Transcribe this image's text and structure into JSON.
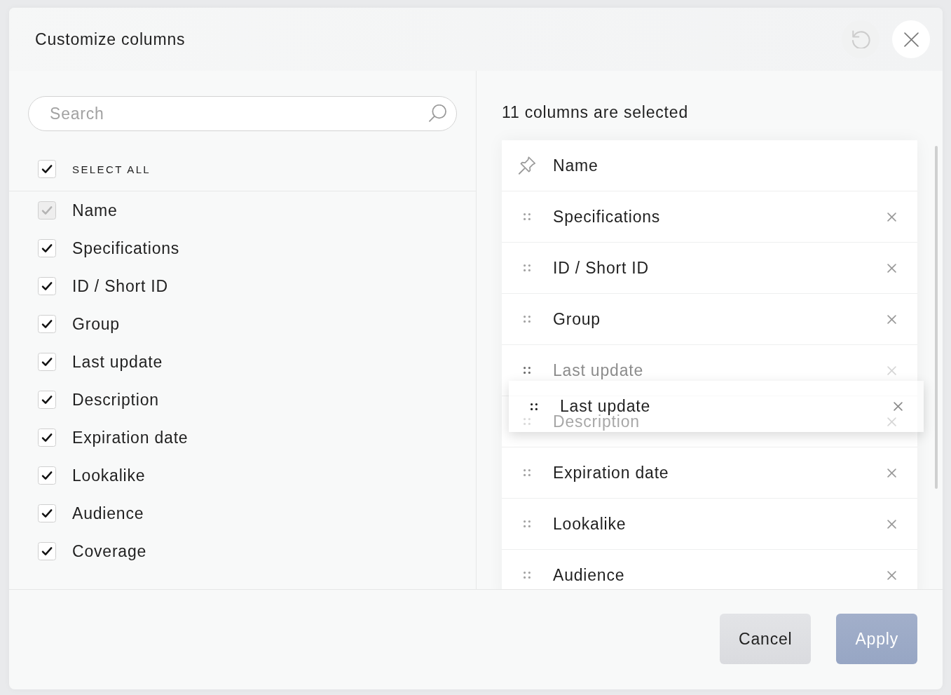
{
  "dialog": {
    "title": "Customize columns",
    "header_actions": [
      {
        "kind": "reset",
        "disabled": true
      },
      {
        "kind": "close",
        "disabled": false
      }
    ]
  },
  "available": {
    "search": {
      "placeholder": "Search"
    },
    "select_all": {
      "label": "SELECT ALL",
      "checked": true
    },
    "columns": [
      {
        "label": "Name",
        "checked": true,
        "disabled": true
      },
      {
        "label": "Specifications",
        "checked": true,
        "disabled": false
      },
      {
        "label": "ID / Short ID",
        "checked": true,
        "disabled": false
      },
      {
        "label": "Group",
        "checked": true,
        "disabled": false
      },
      {
        "label": "Last update",
        "checked": true,
        "disabled": false
      },
      {
        "label": "Description",
        "checked": true,
        "disabled": false
      },
      {
        "label": "Expiration date",
        "checked": true,
        "disabled": false
      },
      {
        "label": "Lookalike",
        "checked": true,
        "disabled": false
      },
      {
        "label": "Audience",
        "checked": true,
        "disabled": false
      },
      {
        "label": "Coverage",
        "checked": true,
        "disabled": false
      }
    ]
  },
  "selected": {
    "summary": "11 columns are selected",
    "columns": [
      {
        "label": "Name",
        "kind": "pinned"
      },
      {
        "label": "Specifications",
        "kind": "movable"
      },
      {
        "label": "ID / Short ID",
        "kind": "movable"
      },
      {
        "label": "Group",
        "kind": "movable"
      },
      {
        "label": "Last update",
        "kind": "drag_source"
      },
      {
        "label": "Description",
        "kind": "movable"
      },
      {
        "label": "Expiration date",
        "kind": "movable"
      },
      {
        "label": "Lookalike",
        "kind": "movable"
      },
      {
        "label": "Audience",
        "kind": "movable"
      }
    ],
    "drag_preview": {
      "label": "Last update"
    }
  },
  "footer": {
    "buttons": [
      {
        "label": "Cancel",
        "kind": "secondary",
        "disabled": false
      },
      {
        "label": "Apply",
        "kind": "primary",
        "disabled": true
      }
    ]
  }
}
